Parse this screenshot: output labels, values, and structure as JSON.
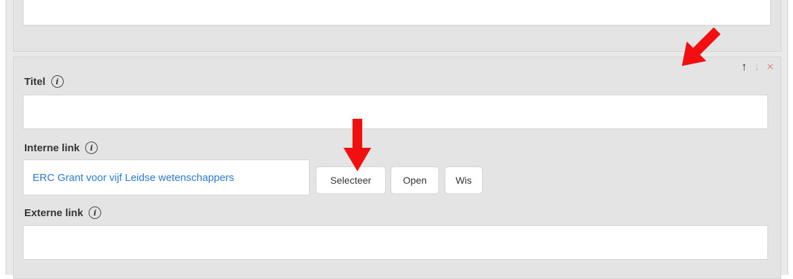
{
  "sections": {
    "titel": {
      "label": "Titel",
      "value": ""
    },
    "interne_link": {
      "label": "Interne link",
      "value": "ERC Grant voor vijf Leidse wetenschappers",
      "buttons": {
        "select": "Selecteer",
        "open": "Open",
        "clear": "Wis"
      }
    },
    "externe_link": {
      "label": "Externe link",
      "value": ""
    }
  },
  "controls": {
    "up": "↑",
    "down": "↓",
    "remove": "×"
  },
  "info_glyph": "i",
  "colors": {
    "link": "#2a78d2",
    "remove": "#ec7d7d",
    "annotation_arrow": "#f20f0f"
  }
}
